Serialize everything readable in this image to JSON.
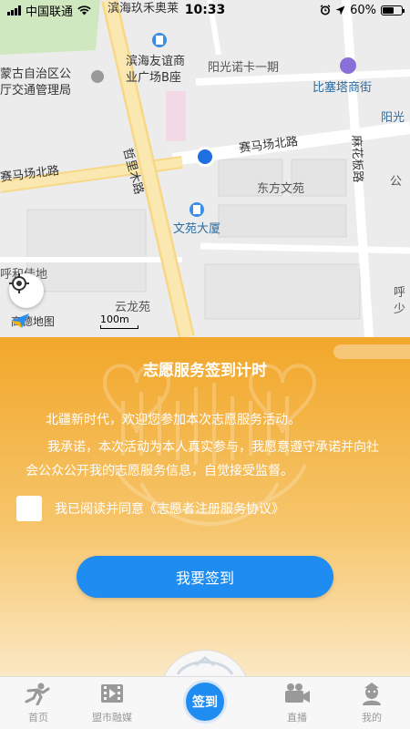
{
  "status_bar": {
    "carrier": "中国联通",
    "time": "10:33",
    "battery": "60%",
    "battery_level": 0.6
  },
  "map": {
    "labels": {
      "binhai_jiuhe": "滨海玖禾奥莱",
      "binhai_youyi": "滨海友谊商",
      "binhai_youyi2": "业广场B座",
      "mongolia1": "蒙古自治区公",
      "mongolia2": "厅交通管理局",
      "yangguang": "阳光诺卡一期",
      "bisaita": "比塞塔商街",
      "yangguang_short": "阳光",
      "zhelimu": "哲里木路",
      "saimachang_n": "赛马场北路",
      "saimachang_w": "赛马场北路",
      "mahuaban": "麻花板路",
      "dongfang": "东方文苑",
      "gong": "公",
      "wenyuan": "文苑大厦",
      "hudejia": "呼和佳地",
      "yunlong": "云龙苑",
      "hu_right": "呼",
      "shao_right": "少"
    },
    "logo_text": "高德地图",
    "scale_text": "100m"
  },
  "panel": {
    "title": "志愿服务签到计时",
    "para1": "北疆新时代，欢迎您参加本次志愿服务活动。",
    "para2": "我承诺，本次活动为本人真实参与，我愿意遵守承诺并向社会公众公开我的志愿服务信息，自觉接受监督。",
    "agree_text": "我已阅读并同意《志愿者注册服务协议》",
    "agree_checked": false,
    "signin_button": "我要签到"
  },
  "tabbar": {
    "tabs": [
      "首页",
      "盟市融媒",
      "直播",
      "我的"
    ],
    "center_label": "签到"
  },
  "colors": {
    "accent_blue": "#1e8cf0",
    "panel_orange": "#f2a72a"
  }
}
